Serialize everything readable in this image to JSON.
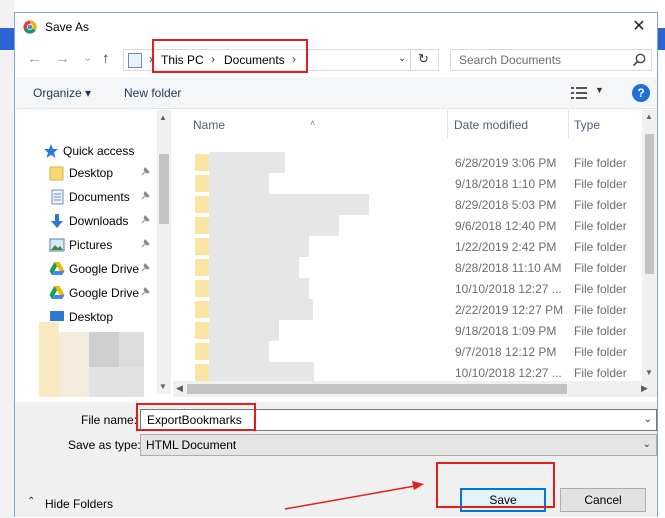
{
  "window": {
    "title": "Save As",
    "close": "✕"
  },
  "nav": {
    "back": "←",
    "forward": "→",
    "recent": "⌄",
    "up": "↑",
    "crumbs": [
      "This PC",
      "Documents"
    ],
    "separator": "›",
    "dropdown": "⌄",
    "refresh": "↻"
  },
  "search": {
    "placeholder": "Search Documents"
  },
  "toolbar": {
    "organize": "Organize ▾",
    "new_folder": "New folder",
    "help": "?"
  },
  "sidebar": {
    "quick_access": "Quick access",
    "items": [
      {
        "label": "Desktop",
        "icon": "folder-icon",
        "pinned": true
      },
      {
        "label": "Documents",
        "icon": "documents-icon",
        "pinned": true
      },
      {
        "label": "Downloads",
        "icon": "download-icon",
        "pinned": true
      },
      {
        "label": "Pictures",
        "icon": "pictures-icon",
        "pinned": true
      },
      {
        "label": "Google Drive",
        "icon": "google-drive-icon",
        "pinned": true
      },
      {
        "label": "Google Drive",
        "icon": "google-drive-icon",
        "pinned": true
      },
      {
        "label": "Desktop",
        "icon": "desktop-icon",
        "pinned": false
      }
    ]
  },
  "columns": {
    "name": "Name",
    "date": "Date modified",
    "type": "Type"
  },
  "files": [
    {
      "date": "6/28/2019 3:06 PM",
      "type": "File folder"
    },
    {
      "date": "9/18/2018 1:10 PM",
      "type": "File folder"
    },
    {
      "date": "8/29/2018 5:03 PM",
      "type": "File folder"
    },
    {
      "date": "9/6/2018 12:40 PM",
      "type": "File folder"
    },
    {
      "date": "1/22/2019 2:42 PM",
      "type": "File folder"
    },
    {
      "date": "8/28/2018 11:10 AM",
      "type": "File folder"
    },
    {
      "date": "10/10/2018 12:27 ...",
      "type": "File folder"
    },
    {
      "date": "2/22/2019 12:27 PM",
      "type": "File folder"
    },
    {
      "date": "9/18/2018 1:09 PM",
      "type": "File folder"
    },
    {
      "date": "9/7/2018 12:12 PM",
      "type": "File folder"
    },
    {
      "date": "10/10/2018 12:27 ...",
      "type": "File folder"
    }
  ],
  "form": {
    "file_name_label": "File name:",
    "file_name_value": "ExportBookmarks",
    "save_type_label": "Save as type:",
    "save_type_value": "HTML Document",
    "dropdown": "⌄"
  },
  "buttons": {
    "hide_folders": "Hide Folders",
    "hide_caret": "⌃",
    "save": "Save",
    "cancel": "Cancel"
  },
  "colors": {
    "accent": "#0078d7",
    "annotation": "#e02020",
    "help": "#1e6fd9"
  }
}
